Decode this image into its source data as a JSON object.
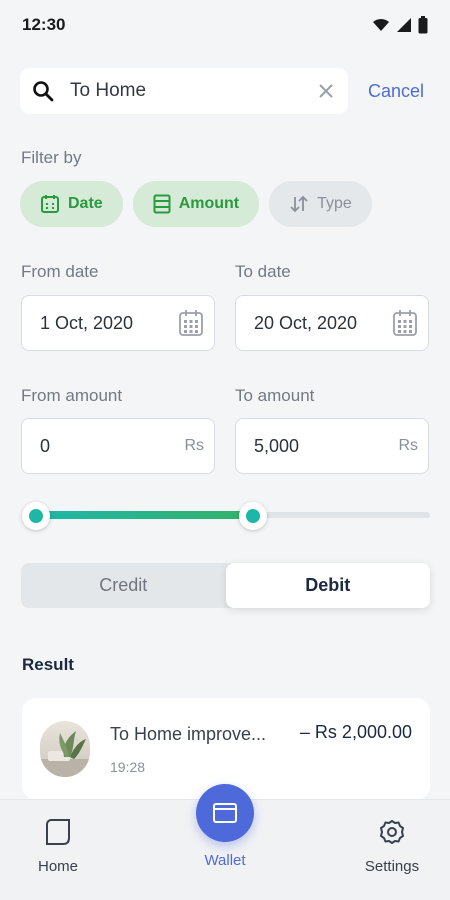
{
  "status_bar": {
    "time": "12:30"
  },
  "search": {
    "value": "To Home",
    "cancel_label": "Cancel"
  },
  "filter": {
    "label": "Filter by",
    "chips": [
      {
        "label": "Date",
        "active": true,
        "icon": "calendar-icon"
      },
      {
        "label": "Amount",
        "active": true,
        "icon": "list-icon"
      },
      {
        "label": "Type",
        "active": false,
        "icon": "sort-icon"
      }
    ]
  },
  "dates": {
    "from_label": "From date",
    "from_value": "1 Oct, 2020",
    "to_label": "To date",
    "to_value": "20 Oct, 2020"
  },
  "amounts": {
    "from_label": "From amount",
    "from_value": "0",
    "to_label": "To amount",
    "to_value": "5,000",
    "unit": "Rs"
  },
  "range_slider": {
    "min_fraction": 0.0,
    "max_fraction": 0.57
  },
  "type_toggle": {
    "credit_label": "Credit",
    "debit_label": "Debit",
    "selected": "Debit"
  },
  "result": {
    "title": "Result",
    "items": [
      {
        "name": "To Home improve...",
        "time": "19:28",
        "amount": "– Rs 2,000.00"
      }
    ]
  },
  "nav": {
    "home_label": "Home",
    "wallet_label": "Wallet",
    "settings_label": "Settings",
    "active": "Wallet"
  },
  "colors": {
    "accent": "#4f6bd8",
    "chip_active_bg": "#d6ead8",
    "chip_active_text": "#2a9a3e",
    "slider_start": "#1eb6a6",
    "slider_end": "#33b36b"
  }
}
